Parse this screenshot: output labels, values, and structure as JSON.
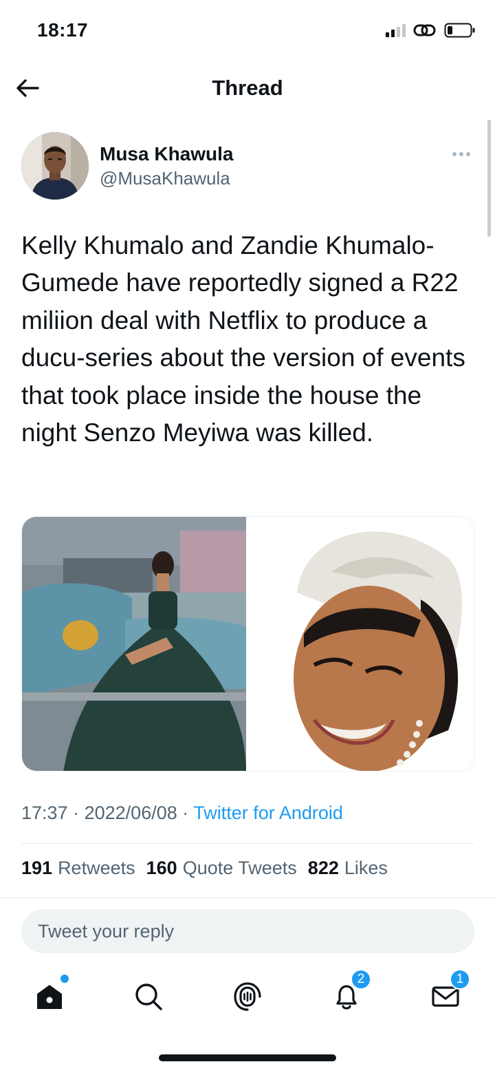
{
  "status_bar": {
    "time": "18:17"
  },
  "header": {
    "title": "Thread"
  },
  "tweet": {
    "author_name": "Musa Khawula",
    "author_handle": "@MusaKhawula",
    "text": "Kelly Khumalo and Zandie Khumalo-Gumede have reportedly signed a R22 miliion deal with Netflix to produce a ducu-series about the version of events that took place inside the house the night Senzo Meyiwa was killed.",
    "time": "17:37",
    "date": "2022/06/08",
    "source": "Twitter for Android",
    "separator": "·",
    "stats": {
      "retweets_count": "191",
      "retweets_label": "Retweets",
      "quotes_count": "160",
      "quotes_label": "Quote Tweets",
      "likes_count": "822",
      "likes_label": "Likes"
    }
  },
  "reply": {
    "placeholder": "Tweet your reply"
  },
  "tabbar": {
    "notifications_badge": "2",
    "messages_badge": "1"
  },
  "colors": {
    "accent": "#1d9bf0",
    "text_primary": "#0f1419",
    "text_secondary": "#536471"
  }
}
